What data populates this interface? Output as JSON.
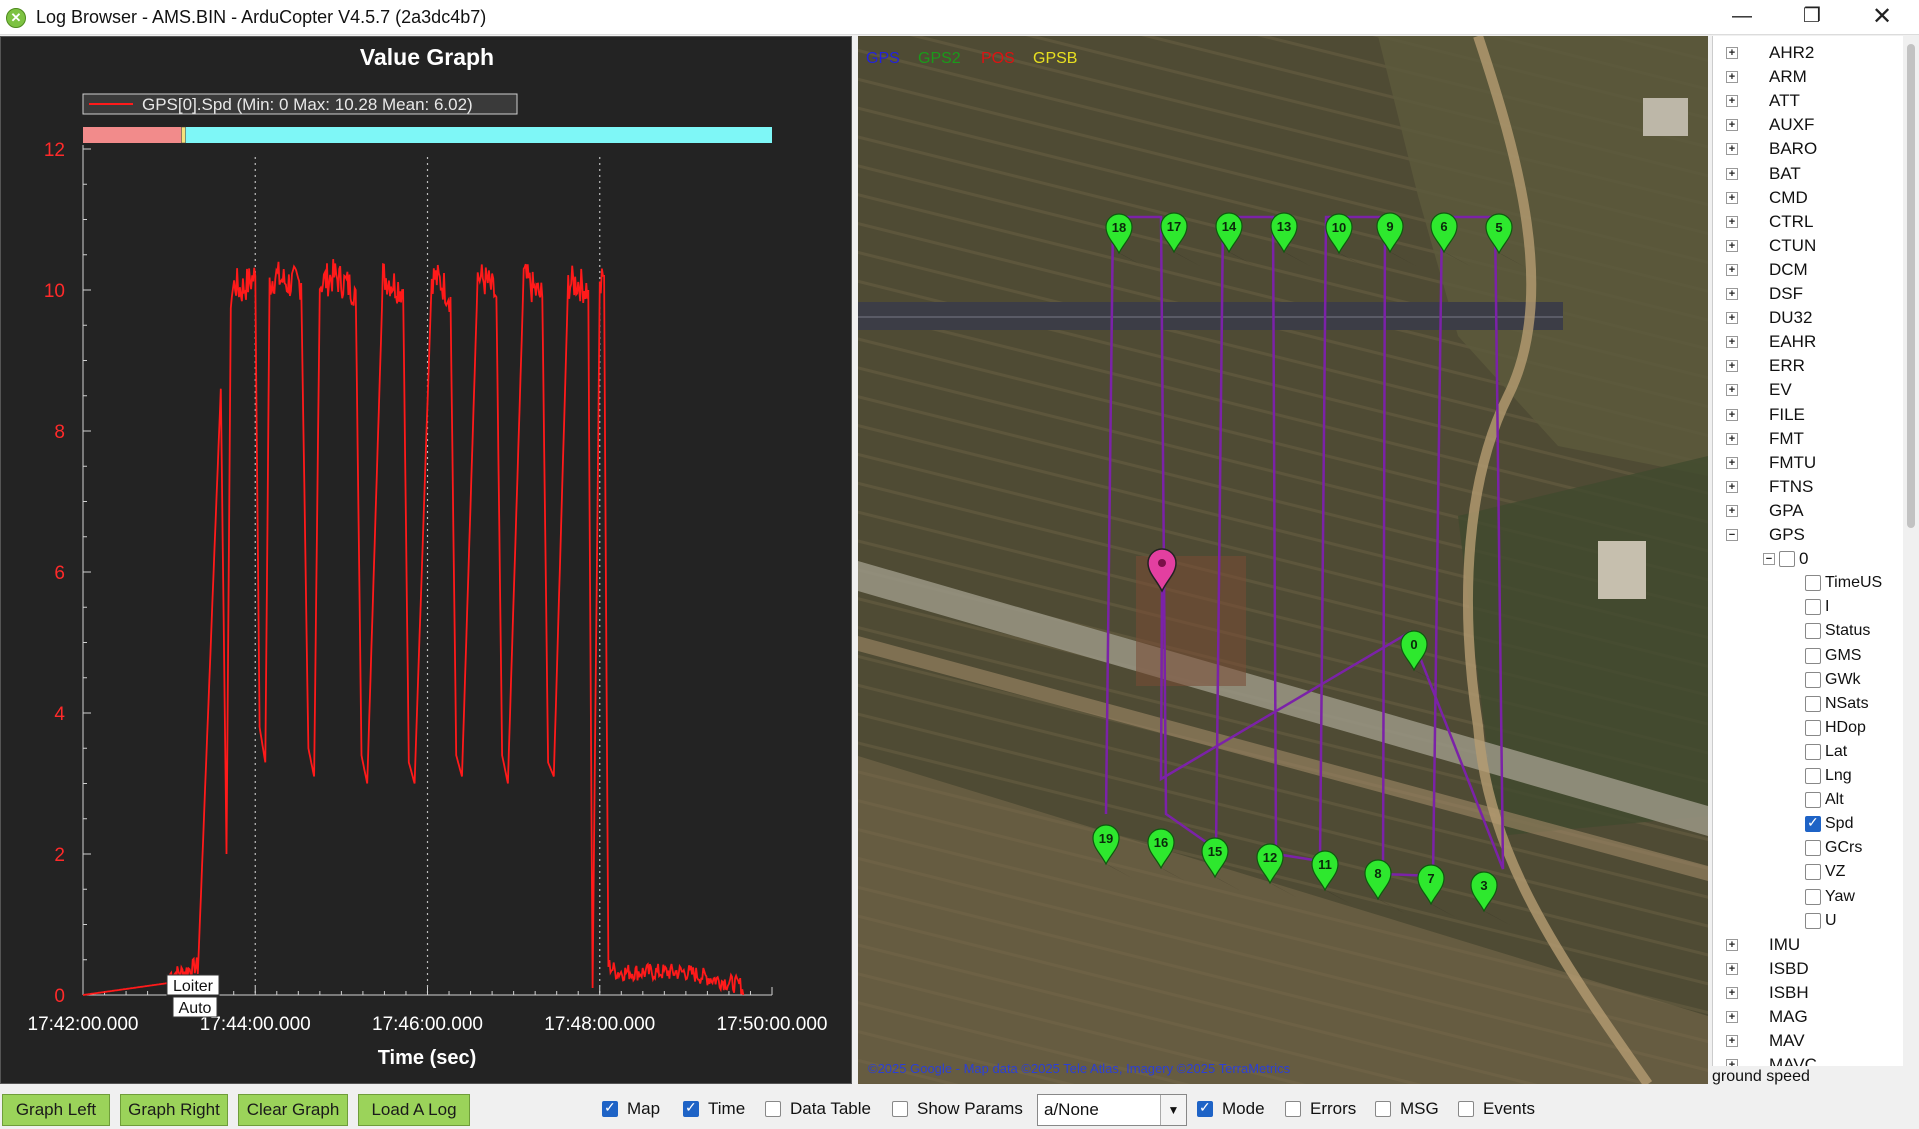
{
  "window": {
    "title": "Log Browser - AMS.BIN - ArduCopter V4.5.7 (2a3dc4b7)",
    "controls": {
      "minimize": "—",
      "maximize": "❐",
      "close": "✕"
    }
  },
  "graph": {
    "title": "Value Graph",
    "legend": "GPS[0].Spd  (Min: 0 Max: 10.28 Mean: 6.02)",
    "mode_labels": [
      "Loiter",
      "Auto"
    ]
  },
  "chart_data": {
    "type": "line",
    "title": "Value Graph",
    "xlabel": "Time (sec)",
    "ylabel": "",
    "ylim": [
      0,
      12
    ],
    "yticks": [
      0,
      2,
      4,
      6,
      8,
      10,
      12
    ],
    "xlim_minutes": [
      0,
      8
    ],
    "xticks": [
      "17:42:00.000",
      "17:44:00.000",
      "17:46:00.000",
      "17:48:00.000",
      "17:50:00.000"
    ],
    "grid": "vertical dotted at major ticks",
    "mode_bar": [
      {
        "mode": "Loiter",
        "color": "#f28b8b",
        "end": "17:43:10"
      },
      {
        "mode": "Auto",
        "color": "#7ef7f7",
        "end": "17:50:00"
      }
    ],
    "series": [
      {
        "name": "GPS[0].Spd",
        "color": "#ff1a1a",
        "x": [
          "17:42:00",
          "17:43:10",
          "17:43:20",
          "17:43:36",
          "17:43:40",
          "17:43:43",
          "17:43:46",
          "17:43:50",
          "17:44:00",
          "17:44:03",
          "17:44:07",
          "17:44:10",
          "17:44:14",
          "17:44:22",
          "17:44:32",
          "17:44:37",
          "17:44:41",
          "17:44:45",
          "17:44:55",
          "17:45:02",
          "17:45:10",
          "17:45:14",
          "17:45:18",
          "17:45:29",
          "17:45:36",
          "17:45:43",
          "17:45:47",
          "17:45:51",
          "17:46:03",
          "17:46:10",
          "17:46:16",
          "17:46:20",
          "17:46:24",
          "17:46:35",
          "17:46:42",
          "17:46:48",
          "17:46:52",
          "17:46:56",
          "17:47:07",
          "17:47:14",
          "17:47:20",
          "17:47:24",
          "17:47:28",
          "17:47:38",
          "17:47:45",
          "17:47:52",
          "17:47:55",
          "17:48:00",
          "17:48:03",
          "17:48:06",
          "17:48:12",
          "17:49:00",
          "17:49:40"
        ],
        "y": [
          0,
          0.2,
          0.3,
          8.6,
          2.0,
          9.9,
          10.1,
          10.0,
          10.2,
          3.8,
          3.3,
          10.1,
          10.2,
          10.1,
          10.1,
          3.5,
          3.1,
          10.1,
          10.2,
          10.1,
          10.0,
          3.4,
          3.0,
          10.2,
          10.1,
          10.0,
          3.3,
          3.0,
          10.2,
          10.1,
          9.9,
          3.4,
          3.1,
          10.2,
          10.1,
          9.9,
          3.4,
          3.0,
          10.2,
          10.0,
          9.9,
          3.3,
          3.1,
          10.1,
          10.1,
          10.0,
          0.1,
          10.0,
          10.2,
          0.3,
          0.2,
          0.2,
          0.0
        ]
      }
    ]
  },
  "map": {
    "layers": [
      {
        "name": "GPS",
        "color": "#2222dd"
      },
      {
        "name": "GPS2",
        "color": "#1a9a1a"
      },
      {
        "name": "POS",
        "color": "#dd1111"
      },
      {
        "name": "GPSB",
        "color": "#e8e020"
      }
    ],
    "waypoints": [
      "18",
      "17",
      "14",
      "13",
      "10",
      "9",
      "6",
      "5",
      "0",
      "19",
      "16",
      "15",
      "12",
      "11",
      "8",
      "7",
      "3"
    ],
    "attribution": "©2025 Google - Map data ©2025 Tele Atlas, Imagery ©2025 TerraMetrics"
  },
  "tree": {
    "top_items": [
      "AHR2",
      "ARM",
      "ATT",
      "AUXF",
      "BARO",
      "BAT",
      "CMD",
      "CTRL",
      "CTUN",
      "DCM",
      "DSF",
      "DU32",
      "EAHR",
      "ERR",
      "EV",
      "FILE",
      "FMT",
      "FMTU",
      "FTNS",
      "GPA",
      "GPS"
    ],
    "gps_instance": "0",
    "gps_fields": [
      {
        "label": "TimeUS",
        "checked": false
      },
      {
        "label": "I",
        "checked": false
      },
      {
        "label": "Status",
        "checked": false
      },
      {
        "label": "GMS",
        "checked": false
      },
      {
        "label": "GWk",
        "checked": false
      },
      {
        "label": "NSats",
        "checked": false
      },
      {
        "label": "HDop",
        "checked": false
      },
      {
        "label": "Lat",
        "checked": false
      },
      {
        "label": "Lng",
        "checked": false
      },
      {
        "label": "Alt",
        "checked": false
      },
      {
        "label": "Spd",
        "checked": true
      },
      {
        "label": "GCrs",
        "checked": false
      },
      {
        "label": "VZ",
        "checked": false
      },
      {
        "label": "Yaw",
        "checked": false
      },
      {
        "label": "U",
        "checked": false
      }
    ],
    "bottom_items": [
      "IMU",
      "ISBD",
      "ISBH",
      "MAG",
      "MAV",
      "MAVC"
    ],
    "status": "ground speed"
  },
  "bottom_bar": {
    "buttons": [
      "Graph Left",
      "Graph Right",
      "Clear Graph",
      "Load A Log"
    ],
    "options": [
      {
        "label": "Map",
        "checked": true
      },
      {
        "label": "Time",
        "checked": true
      },
      {
        "label": "Data Table",
        "checked": false
      },
      {
        "label": "Show Params",
        "checked": false
      }
    ],
    "mode_select": "a/None",
    "options2": [
      {
        "label": "Mode",
        "checked": true
      },
      {
        "label": "Errors",
        "checked": false
      },
      {
        "label": "MSG",
        "checked": false
      },
      {
        "label": "Events",
        "checked": false
      }
    ]
  }
}
